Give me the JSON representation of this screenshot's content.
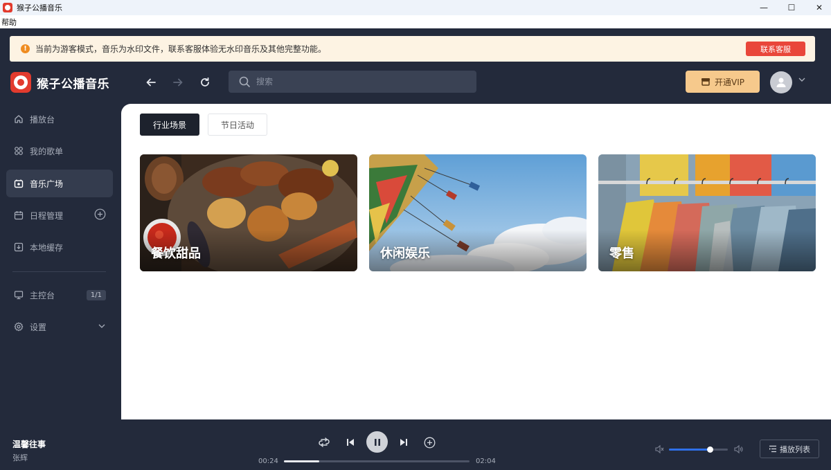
{
  "window": {
    "title": "猴子公播音乐",
    "minimize": "—",
    "maximize": "☐",
    "close": "✕"
  },
  "menu": {
    "help": "帮助"
  },
  "notice": {
    "icon": "warning-icon",
    "text": "当前为游客模式，音乐为水印文件，联系客服体验无水印音乐及其他完整功能。",
    "button": "联系客服"
  },
  "brand": {
    "name": "猴子公播音乐"
  },
  "topbar": {
    "search_placeholder": "搜索",
    "vip_label": "开通VIP"
  },
  "sidebar": {
    "items": [
      {
        "label": "播放台",
        "icon": "home-icon",
        "active": false
      },
      {
        "label": "我的歌单",
        "icon": "playlist-icon",
        "active": false
      },
      {
        "label": "音乐广场",
        "icon": "music-square-icon",
        "active": true
      },
      {
        "label": "日程管理",
        "icon": "calendar-icon",
        "active": false
      },
      {
        "label": "本地缓存",
        "icon": "download-icon",
        "active": false
      }
    ],
    "console": {
      "label": "主控台",
      "badge": "1/1",
      "icon": "monitor-icon"
    },
    "settings": {
      "label": "设置",
      "icon": "gear-icon"
    }
  },
  "main": {
    "tabs": [
      {
        "label": "行业场景",
        "active": true
      },
      {
        "label": "节日活动",
        "active": false
      }
    ],
    "cards": [
      {
        "label": "餐饮甜品",
        "image": "food-grill"
      },
      {
        "label": "休闲娱乐",
        "image": "swing-ride"
      },
      {
        "label": "零售",
        "image": "clothing-rack"
      }
    ]
  },
  "player": {
    "title": "温馨往事",
    "artist": "张辉",
    "current_time": "00:24",
    "total_time": "02:04",
    "progress_percent": 19,
    "volume_percent": 70,
    "playlist_label": "播放列表"
  },
  "colors": {
    "accent": "#e9463a",
    "dark_bg": "#232a3b",
    "vip": "#f6c98c",
    "volume": "#2f6fe8"
  }
}
